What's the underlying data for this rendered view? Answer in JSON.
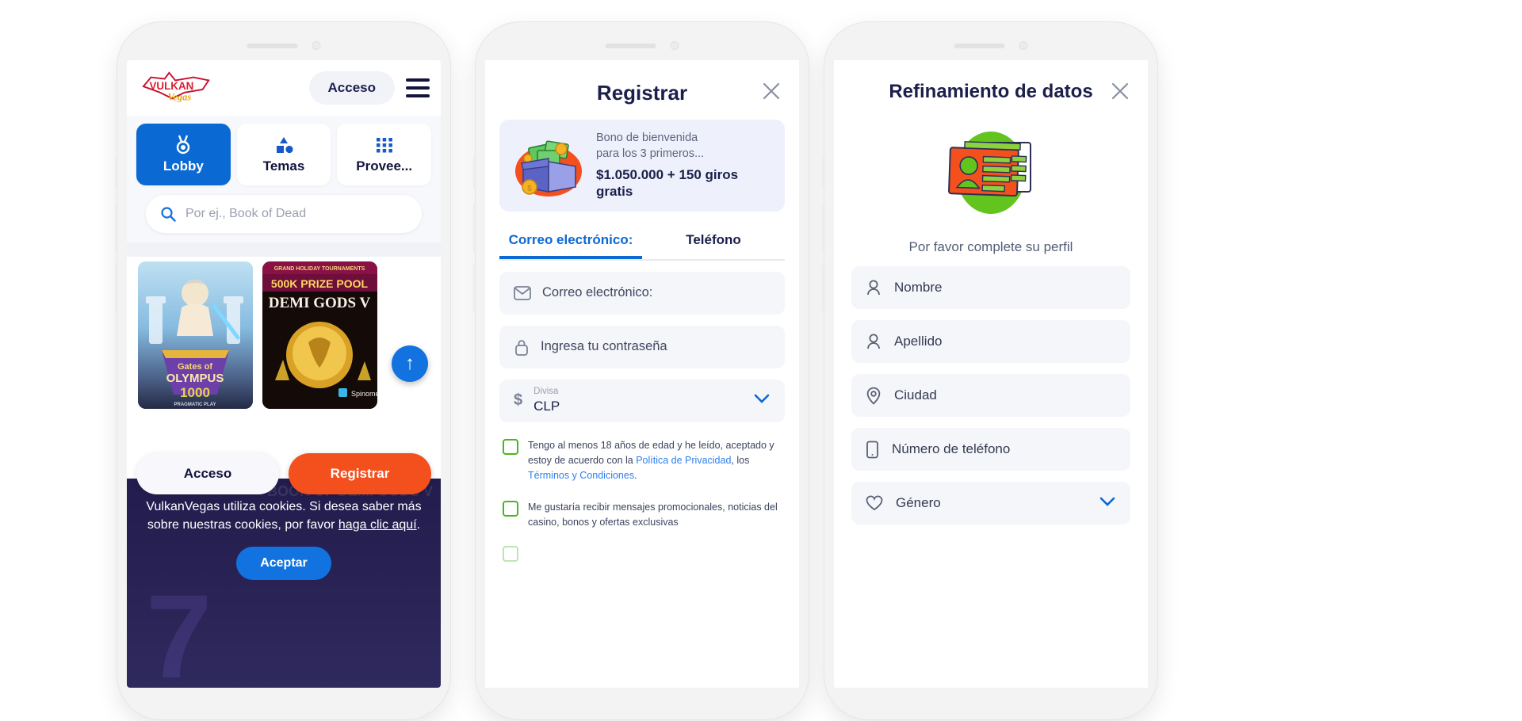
{
  "phone1": {
    "logo_text": "VULKAN Vegas",
    "header": {
      "login_label": "Acceso",
      "menu_icon": "hamburger-icon"
    },
    "tabs": [
      {
        "label": "Lobby",
        "icon": "medal-icon",
        "active": true
      },
      {
        "label": "Temas",
        "icon": "shapes-icon",
        "active": false
      },
      {
        "label": "Provee...",
        "icon": "grid-dots-icon",
        "active": false
      }
    ],
    "search": {
      "placeholder": "Por ej., Book of Dead",
      "icon": "search-icon"
    },
    "games": [
      {
        "title": "Gates of OLYMPUS 1000",
        "provider": "PRAGMATIC PLAY"
      },
      {
        "title": "DEMI GODS V",
        "banner": "GRAND HOLIDAY TOURNAMENTS",
        "prize": "500K PRIZE POOL",
        "provider": "Spinomenal"
      }
    ],
    "scroll_top_icon": "arrow-up-icon",
    "cta": {
      "login_label": "Acceso",
      "register_label": "Registrar"
    },
    "cookie": {
      "text_part1": "VulkanVegas utiliza cookies. Si desea saber más sobre nuestras cookies, por favor ",
      "link_text": "haga clic aquí",
      "text_part2": ".",
      "accept_label": "Aceptar",
      "bg_number": "7",
      "bg_caption": "BOOK OF DEMI GODS V"
    }
  },
  "phone2": {
    "title": "Registrar",
    "close_icon": "close-icon",
    "bonus": {
      "line1": "Bono de bienvenida",
      "line2": "para los 3 primeros...",
      "amount": "$1.050.000 + 150 giros gratis",
      "icon": "money-box-icon"
    },
    "tabs": [
      {
        "label": "Correo electrónico:",
        "active": true
      },
      {
        "label": "Teléfono",
        "active": false
      }
    ],
    "fields": [
      {
        "name": "email",
        "label": "Correo electrónico:",
        "icon": "envelope-icon"
      },
      {
        "name": "password",
        "label": "Ingresa tu contraseña",
        "icon": "lock-icon"
      }
    ],
    "currency": {
      "caption": "Divisa",
      "value": "CLP",
      "prefix_icon": "dollar-icon",
      "chevron_icon": "chevron-down-icon"
    },
    "checkboxes": [
      {
        "pre": "Tengo al menos 18 años de edad y he leído, aceptado y estoy de acuerdo con la ",
        "link1": "Política de Privacidad",
        "mid": ", los ",
        "link2": "Términos y Condiciones",
        "post": "."
      },
      {
        "pre": "Me gustaría recibir mensajes promocionales, noticias del casino, bonos y ofertas exclusivas",
        "link1": "",
        "mid": "",
        "link2": "",
        "post": ""
      }
    ]
  },
  "phone3": {
    "title": "Refinamiento de datos",
    "close_icon": "close-icon",
    "illustration_icon": "id-card-icon",
    "subtitle": "Por favor complete su perfil",
    "fields": [
      {
        "label": "Nombre",
        "icon": "user-icon",
        "dropdown": false
      },
      {
        "label": "Apellido",
        "icon": "user-icon",
        "dropdown": false
      },
      {
        "label": "Ciudad",
        "icon": "map-pin-icon",
        "dropdown": false
      },
      {
        "label": "Número de teléfono",
        "icon": "phone-icon",
        "dropdown": false
      },
      {
        "label": "Género",
        "icon": "heart-icon",
        "dropdown": true
      }
    ]
  },
  "colors": {
    "primary_blue": "#0b69d4",
    "orange": "#f4501e",
    "dark_navy": "#1b1f4b",
    "green_check": "#45b81e",
    "link_blue": "#2d7ff0"
  }
}
